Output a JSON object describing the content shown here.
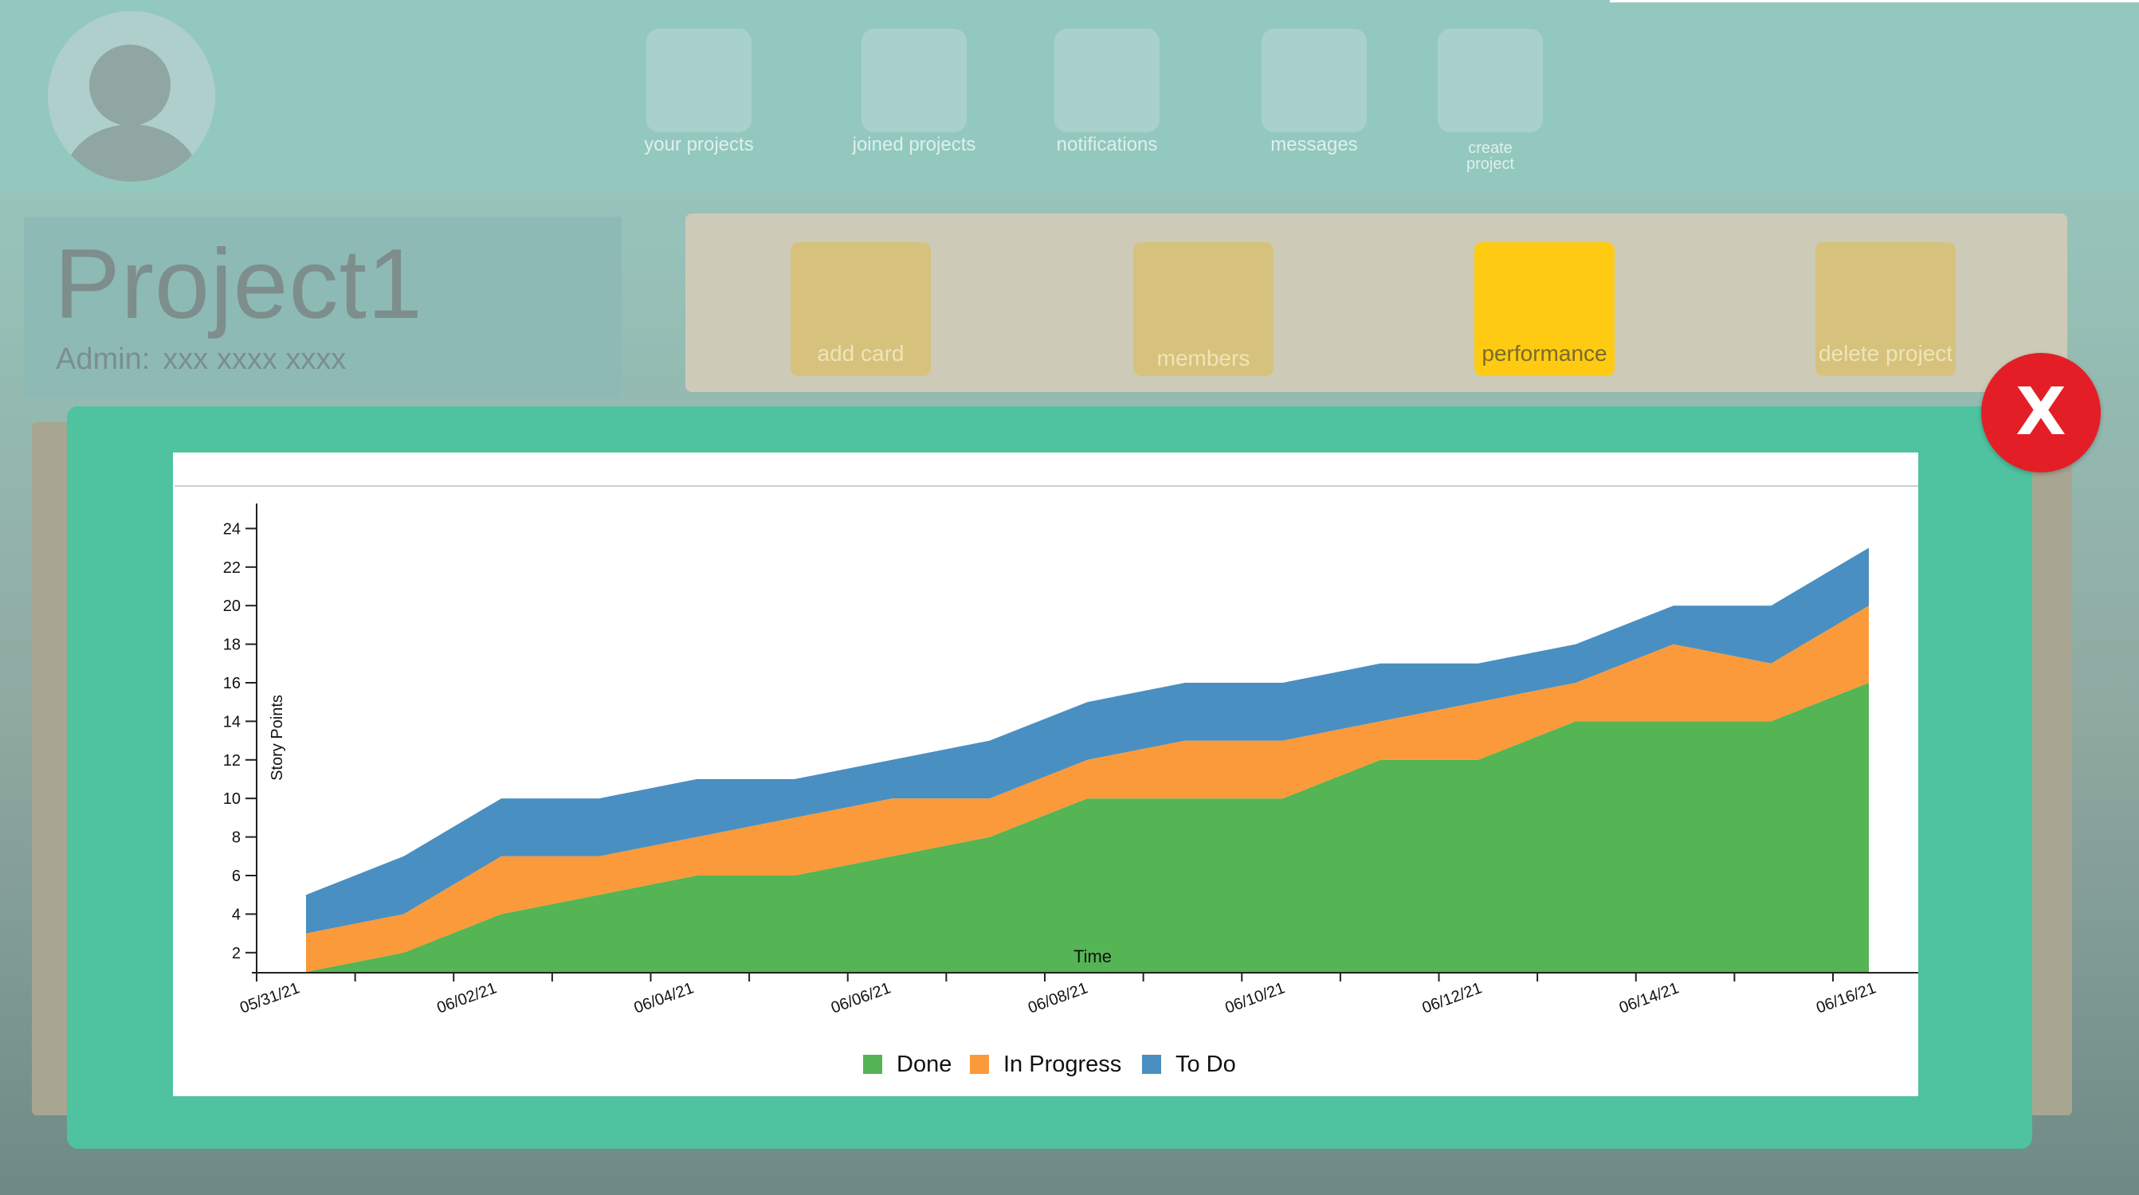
{
  "header": {
    "nav": [
      {
        "label": "your projects",
        "icon": "projects-icon"
      },
      {
        "label": "joined projects",
        "icon": "joined-projects-icon"
      },
      {
        "label": "notifications",
        "icon": "notifications-icon"
      },
      {
        "label": "messages",
        "icon": "messages-icon"
      },
      {
        "label": "create project",
        "icon": "create-project-icon"
      }
    ]
  },
  "project": {
    "title": "Project1",
    "admin_label": "Admin:",
    "admin_value": "xxx xxxx xxxx"
  },
  "actions": {
    "add_card": "add card",
    "members": "members",
    "performance": "performance",
    "delete_project": "delete project",
    "active": "performance",
    "active_color": "#fecb12"
  },
  "modal": {
    "close_label": "X",
    "close_color": "#e41e26",
    "background_color": "#4fc29f"
  },
  "chart_data": {
    "type": "area",
    "stacked": true,
    "xlabel": "Time",
    "ylabel": "Story Points",
    "ylim": [
      1,
      25
    ],
    "yticks": [
      2,
      4,
      6,
      8,
      10,
      12,
      14,
      16,
      18,
      20,
      22,
      24
    ],
    "xtick_labels": [
      "05/31/21",
      "06/02/21",
      "06/04/21",
      "06/06/21",
      "06/08/21",
      "06/10/21",
      "06/12/21",
      "06/14/21",
      "06/16/21"
    ],
    "x": [
      "2021-05-31",
      "2021-06-01",
      "2021-06-02",
      "2021-06-03",
      "2021-06-04",
      "2021-06-05",
      "2021-06-06",
      "2021-06-07",
      "2021-06-08",
      "2021-06-09",
      "2021-06-10",
      "2021-06-11",
      "2021-06-12",
      "2021-06-13",
      "2021-06-14",
      "2021-06-15",
      "2021-06-16"
    ],
    "series": [
      {
        "name": "Done",
        "color": "#55b454",
        "values": [
          1,
          2,
          4,
          5,
          6,
          6,
          7,
          8,
          10,
          10,
          10,
          12,
          12,
          14,
          14,
          14,
          16
        ]
      },
      {
        "name": "In Progress",
        "color": "#fb9a3a",
        "values": [
          2,
          2,
          3,
          2,
          2,
          3,
          3,
          2,
          2,
          3,
          3,
          2,
          3,
          2,
          4,
          3,
          4
        ]
      },
      {
        "name": "To Do",
        "color": "#4a8fc1",
        "values": [
          2,
          3,
          3,
          3,
          3,
          2,
          2,
          3,
          3,
          3,
          3,
          3,
          2,
          2,
          2,
          3,
          3
        ]
      }
    ],
    "grid": false,
    "legend_position": "bottom"
  }
}
